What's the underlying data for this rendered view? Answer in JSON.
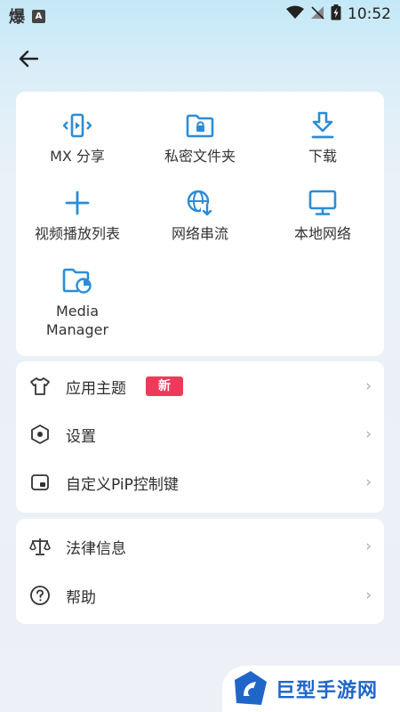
{
  "status_bar": {
    "time": "10:52",
    "left_glyph": "爆",
    "left_badge": "A"
  },
  "header": {
    "back_icon": "arrow-left-icon"
  },
  "grid": [
    {
      "label": "MX 分享",
      "icon": "share-icon"
    },
    {
      "label": "私密文件夹",
      "icon": "lock-folder-icon"
    },
    {
      "label": "下载",
      "icon": "download-icon"
    },
    {
      "label": "视频播放列表",
      "icon": "plus-icon"
    },
    {
      "label": "网络串流",
      "icon": "globe-download-icon"
    },
    {
      "label": "本地网络",
      "icon": "monitor-icon"
    },
    {
      "label": "Media\nManager",
      "icon": "folder-chart-icon"
    }
  ],
  "settings": {
    "theme_label": "应用主题",
    "theme_badge": "新",
    "settings_label": "设置",
    "pip_label": "自定义PiP控制键"
  },
  "legal": {
    "legal_label": "法律信息",
    "help_label": "帮助"
  },
  "watermark": {
    "text": "巨型手游网"
  },
  "colors": {
    "accent": "#2b8cd6",
    "badge": "#ee3a5a",
    "watermark": "#1f66c8"
  }
}
